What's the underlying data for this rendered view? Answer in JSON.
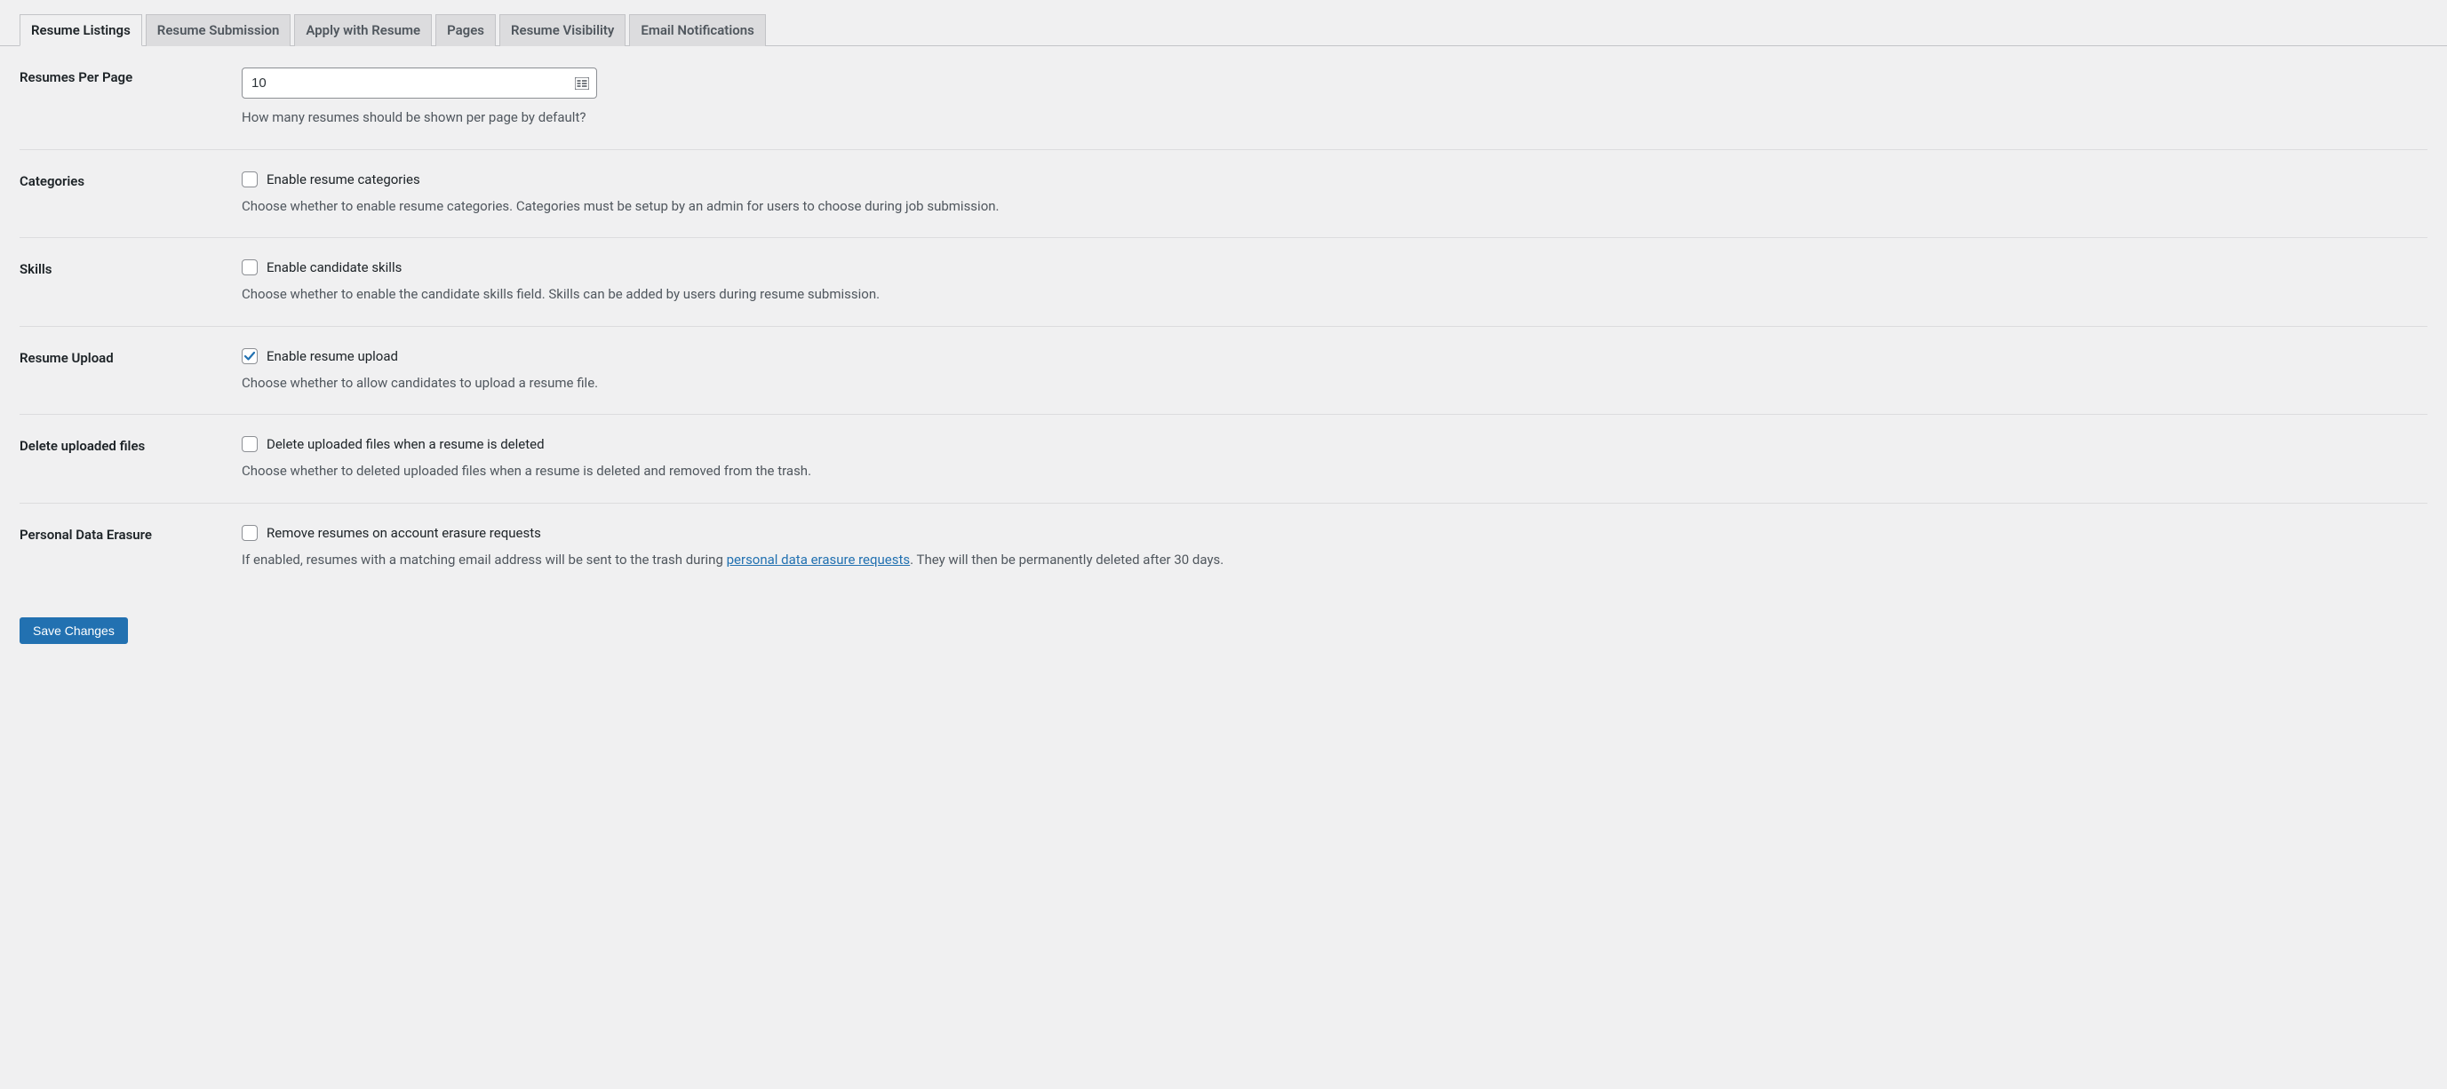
{
  "tabs": {
    "resume_listings": "Resume Listings",
    "resume_submission": "Resume Submission",
    "apply_with_resume": "Apply with Resume",
    "pages": "Pages",
    "resume_visibility": "Resume Visibility",
    "email_notifications": "Email Notifications"
  },
  "fields": {
    "resumes_per_page": {
      "label": "Resumes Per Page",
      "value": "10",
      "description": "How many resumes should be shown per page by default?"
    },
    "categories": {
      "label": "Categories",
      "checkbox_label": "Enable resume categories",
      "description": "Choose whether to enable resume categories. Categories must be setup by an admin for users to choose during job submission."
    },
    "skills": {
      "label": "Skills",
      "checkbox_label": "Enable candidate skills",
      "description": "Choose whether to enable the candidate skills field. Skills can be added by users during resume submission."
    },
    "resume_upload": {
      "label": "Resume Upload",
      "checkbox_label": "Enable resume upload",
      "description": "Choose whether to allow candidates to upload a resume file."
    },
    "delete_uploaded": {
      "label": "Delete uploaded files",
      "checkbox_label": "Delete uploaded files when a resume is deleted",
      "description": "Choose whether to deleted uploaded files when a resume is deleted and removed from the trash."
    },
    "personal_data_erasure": {
      "label": "Personal Data Erasure",
      "checkbox_label": "Remove resumes on account erasure requests",
      "description_before": "If enabled, resumes with a matching email address will be sent to the trash during ",
      "description_link": "personal data erasure requests",
      "description_after": ". They will then be permanently deleted after 30 days."
    }
  },
  "save_button": "Save Changes"
}
